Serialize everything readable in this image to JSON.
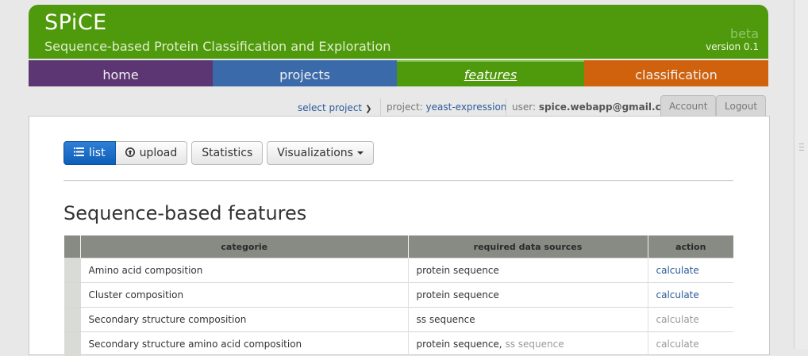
{
  "header": {
    "title": "SPiCE",
    "subtitle": "Sequence-based Protein Classification and Exploration",
    "badge": "beta",
    "version": "version 0.1"
  },
  "nav": {
    "home": "home",
    "projects": "projects",
    "features": "features",
    "classification": "classification"
  },
  "userbar": {
    "select_project": "select project",
    "project_label": "project:",
    "project_name": "yeast-expression",
    "user_label": "user:",
    "user_email": "spice.webapp@gmail.com",
    "account": "Account",
    "logout": "Logout"
  },
  "toolbar": {
    "list": "list",
    "upload": "upload",
    "statistics": "Statistics",
    "visualizations": "Visualizations"
  },
  "section_title": "Sequence-based features",
  "table": {
    "headers": [
      "categorie",
      "required data sources",
      "action"
    ],
    "rows": [
      {
        "category": "Amino acid composition",
        "sources": "protein sequence",
        "sources_extra": "",
        "action": "calculate"
      },
      {
        "category": "Cluster composition",
        "sources": "protein sequence",
        "sources_extra": "",
        "action": "calculate"
      },
      {
        "category": "Secondary structure composition",
        "sources": "ss sequence",
        "sources_extra": "",
        "action": "calculate"
      },
      {
        "category": "Secondary structure amino acid composition",
        "sources": "protein sequence,",
        "sources_extra": "ss sequence",
        "action": "calculate"
      }
    ]
  },
  "colors": {
    "header_green": "#4f9a0c",
    "nav_home": "#5c3672",
    "nav_projects": "#3b6aaa",
    "nav_classification": "#d0620d",
    "link_blue": "#2a5a99"
  }
}
